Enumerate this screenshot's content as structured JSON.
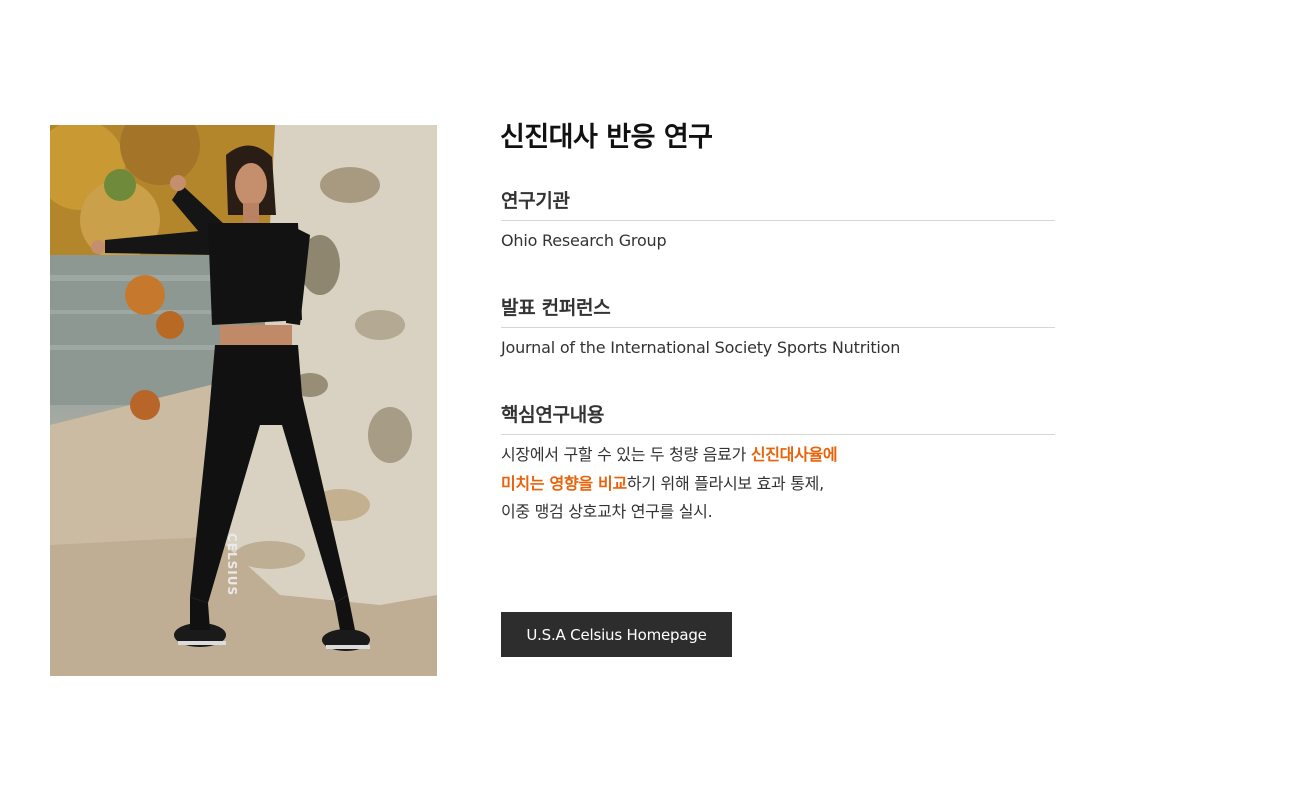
{
  "study": {
    "title": "신진대사 반응 연구",
    "institution": {
      "heading": "연구기관",
      "value": "Ohio Research Group"
    },
    "conference": {
      "heading": "발표 컨퍼런스",
      "value": "Journal of the International Society Sports Nutrition"
    },
    "key_findings": {
      "heading": "핵심연구내용",
      "line1_plain": "시장에서 구할 수 있는 두 청량 음료가 ",
      "line1_highlight": "신진대사율에",
      "line2_highlight": "미치는 영향을 비교",
      "line2_plain": "하기 위해 플라시보 효과 통제,",
      "line3_plain": "이중 맹검 상호교차 연구를 실시."
    }
  },
  "photo": {
    "leggings_brand": "CELSIUS"
  },
  "homepage_button": {
    "label": "U.S.A Celsius Homepage"
  },
  "colors": {
    "highlight": "#e8630a",
    "button_bg": "#2d2d2d",
    "divider": "#d6d6d6"
  }
}
